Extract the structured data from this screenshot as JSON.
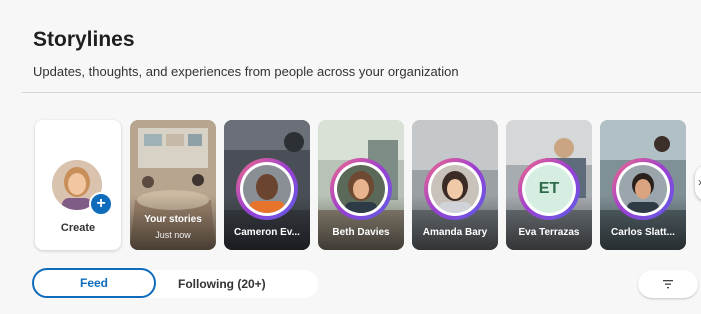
{
  "header": {
    "title": "Storylines",
    "subtitle": "Updates, thoughts, and experiences from people across your organization"
  },
  "create": {
    "label": "Create"
  },
  "your_stories": {
    "title": "Your stories",
    "subtitle": "Just now"
  },
  "stories": [
    {
      "name": "Cameron Ev..."
    },
    {
      "name": "Beth Davies"
    },
    {
      "name": "Amanda Bary"
    },
    {
      "name": "Eva Terrazas",
      "initials": "ET"
    },
    {
      "name": "Carlos Slatt..."
    }
  ],
  "tabs": {
    "feed": "Feed",
    "following": "Following (20+)"
  },
  "icons": {
    "create_plus": "plus-icon",
    "next": "chevron-right-icon",
    "filter": "filter-icon"
  },
  "colors": {
    "accent": "#0f6cbd",
    "ring_start": "#f36b8a",
    "ring_end": "#5b5ce8"
  }
}
